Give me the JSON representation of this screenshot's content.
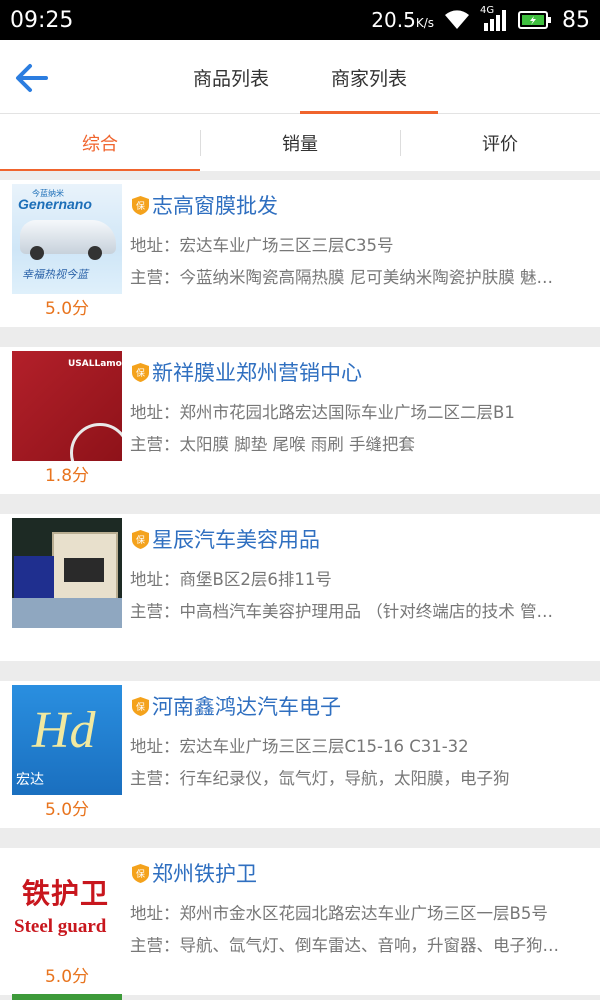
{
  "status": {
    "time": "09:25",
    "speed": "20.5",
    "speed_unit": "K/s",
    "network": "4G",
    "battery": "85"
  },
  "header": {
    "back_icon": "arrow-left-icon",
    "tabs": [
      {
        "label": "商品列表",
        "active": false
      },
      {
        "label": "商家列表",
        "active": true
      }
    ]
  },
  "sort": [
    "综合",
    "销量",
    "评价"
  ],
  "colors": {
    "accent": "#f0642d",
    "link": "#2f6fc0",
    "score": "#e8741e",
    "badge": "#f4a21c"
  },
  "shops": [
    {
      "name": "志高窗膜批发",
      "address": "地址：宏达车业广场三区三层C35号",
      "main": "主营：今蓝纳米陶瓷高隔热膜 尼可美纳米陶瓷护肤膜 魅…",
      "score": "5.0分",
      "thumb_text": [
        "今蓝纳米",
        "Genernano",
        "幸福热视今蓝"
      ]
    },
    {
      "name": "新祥膜业郑州营销中心",
      "address": "地址：郑州市花园北路宏达国际车业广场二区二层B1",
      "main": "主营：太阳膜  脚垫  尾喉  雨刷 手缝把套",
      "score": "1.8分",
      "thumb_text": [
        "USALLamor"
      ]
    },
    {
      "name": "星辰汽车美容用品",
      "address": "地址：商堡B区2层6排11号",
      "main": "主营：中高档汽车美容护理用品 （针对终端店的技术  管…",
      "score": "",
      "thumb_text": []
    },
    {
      "name": "河南鑫鸿达汽车电子",
      "address": "地址：宏达车业广场三区三层C15-16  C31-32",
      "main": "主营：行车纪录仪，氙气灯，导航，太阳膜，电子狗",
      "score": "5.0分",
      "thumb_text": [
        "宏达"
      ]
    },
    {
      "name": "郑州铁护卫",
      "address": "地址：郑州市金水区花园北路宏达车业广场三区一层B5号",
      "main": "主营：导航、氙气灯、倒车雷达、音响，升窗器、电子狗…",
      "score": "5.0分",
      "thumb_text": [
        "铁护卫",
        "Steel guard"
      ]
    }
  ]
}
